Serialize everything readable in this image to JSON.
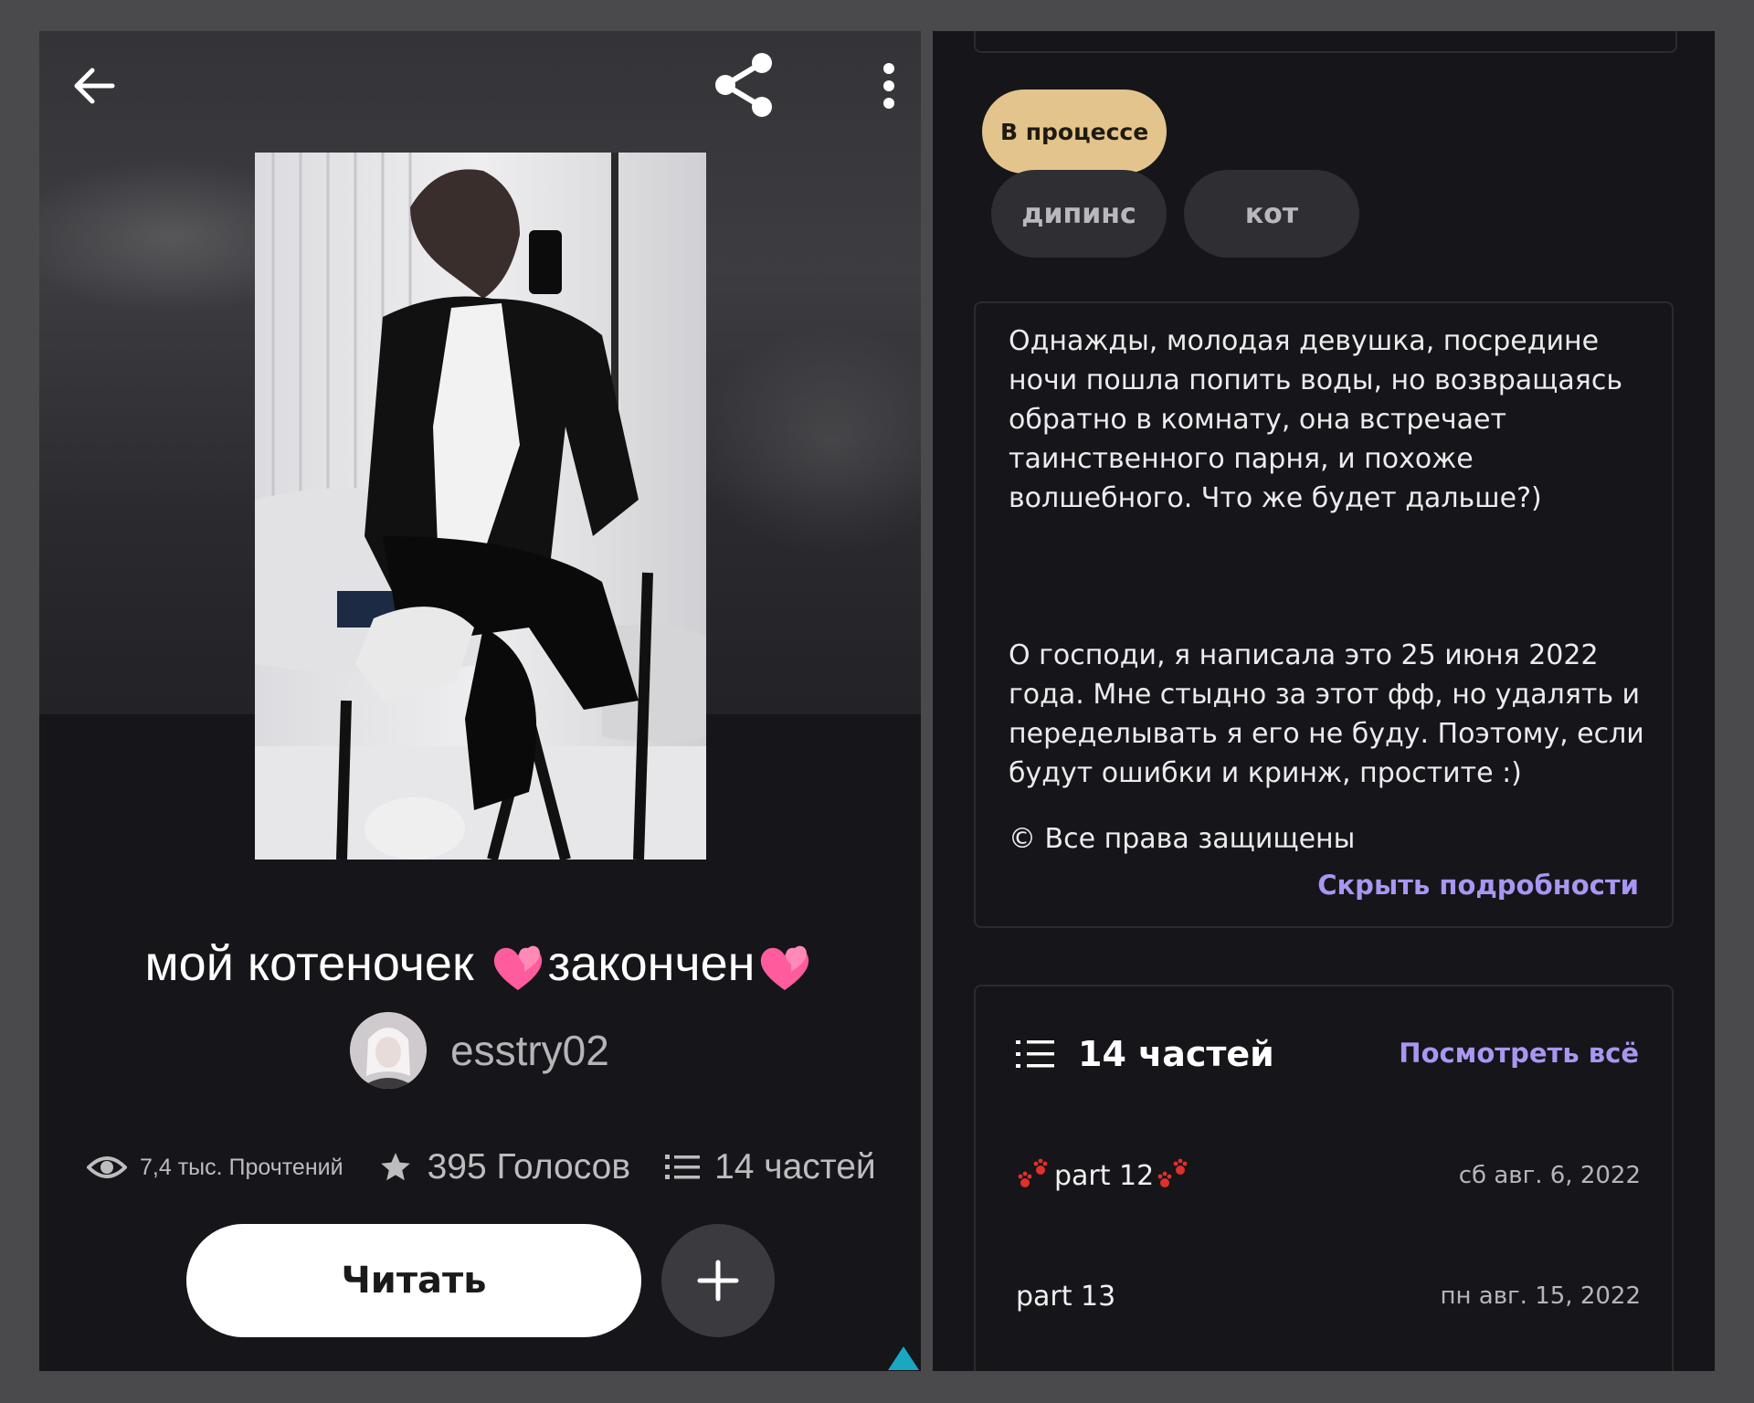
{
  "left": {
    "title": "мой котеночек 💞закончен💞",
    "title_parts": [
      "мой котеночек ",
      "закончен"
    ],
    "author": {
      "name": "esstry02"
    },
    "stats": {
      "reads": "7,4 тыс. Прочтений",
      "votes": "395 Голосов",
      "parts": "14 частей"
    },
    "read_button": "Читать",
    "icons": [
      "back-arrow-icon",
      "share-icon",
      "more-vert-icon",
      "eye-icon",
      "star-icon",
      "list-icon",
      "plus-icon",
      "two-hearts-icon"
    ]
  },
  "right": {
    "status": "В процессе",
    "tags": [
      "дипинс",
      "кот"
    ],
    "description": "Однажды, молодая девушка, посредине ночи пошла попить воды, но возвращаясь обратно в комнату, она встречает таинственного парня, и похоже волшебного. Что же будет дальше?)\n\n\n\nО господи, я написала это 25 июня 2022 года. Мне стыдно за этот фф, но удалять и переделывать я его не буду. Поэтому, если будут ошибки и кринж, простите :)",
    "copyright": "© Все права защищены",
    "hide_details": "Скрыть подробности",
    "parts_header": "14 частей",
    "view_all": "Посмотреть всё",
    "parts": [
      {
        "title": "part 12",
        "date": "сб авг. 6, 2022"
      },
      {
        "title": "part 13",
        "date": "пн авг. 15, 2022"
      }
    ]
  },
  "colors": {
    "background": "#161519",
    "accent_link": "#a996f2",
    "status_pill": "#e3c48c",
    "tag_bg": "#2e2e33"
  }
}
